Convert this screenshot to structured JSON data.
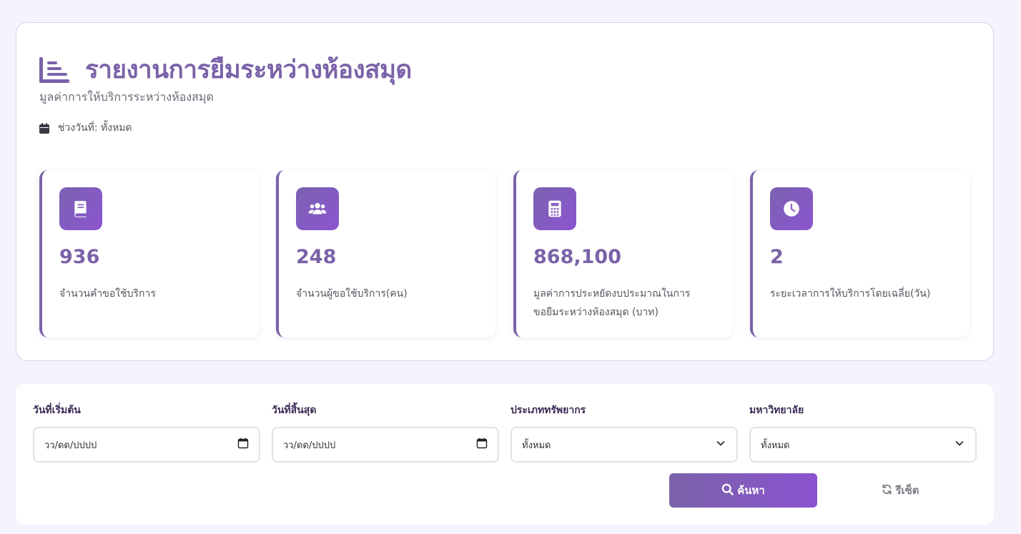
{
  "header": {
    "title": "รายงานการยืมระหว่างห้องสมุด",
    "subtitle": "มูลค่าการให้บริการระหว่างห้องสมุด",
    "date_range": "ช่วงวันที่: ทั้งหมด",
    "title_icon": "list-icon",
    "date_icon": "calendar-icon"
  },
  "stats": [
    {
      "icon": "book-icon",
      "value": "936",
      "label": "จำนวนคำขอใช้บริการ"
    },
    {
      "icon": "users-icon",
      "value": "248",
      "label": "จำนวนผู้ขอใช้บริการ(คน)"
    },
    {
      "icon": "calculator-icon",
      "value": "868,100",
      "label": "มูลค่าการประหยัดงบประมาณในการขอยืมระหว่างห้องสมุด (บาท)"
    },
    {
      "icon": "clock-icon",
      "value": "2",
      "label": "ระยะเวลาการให้บริการโดยเฉลี่ย(วัน)"
    }
  ],
  "filters": {
    "start_date": {
      "label": "วันที่เริ่มต้น",
      "value": "วว/ดด/ปปปป"
    },
    "end_date": {
      "label": "วันที่สิ้นสุด",
      "value": "วว/ดด/ปปปป"
    },
    "resource_type": {
      "label": "ประเภททรัพยากร",
      "value": "ทั้งหมด"
    },
    "university": {
      "label": "มหาวิทยาลัย",
      "value": "ทั้งหมด"
    }
  },
  "actions": {
    "search_label": "ค้นหา",
    "reset_label": "รีเซ็ต"
  },
  "colors": {
    "accent": "#7a62a8",
    "accent_gradient_end": "#8a52cf",
    "background": "#f6f3fc"
  }
}
